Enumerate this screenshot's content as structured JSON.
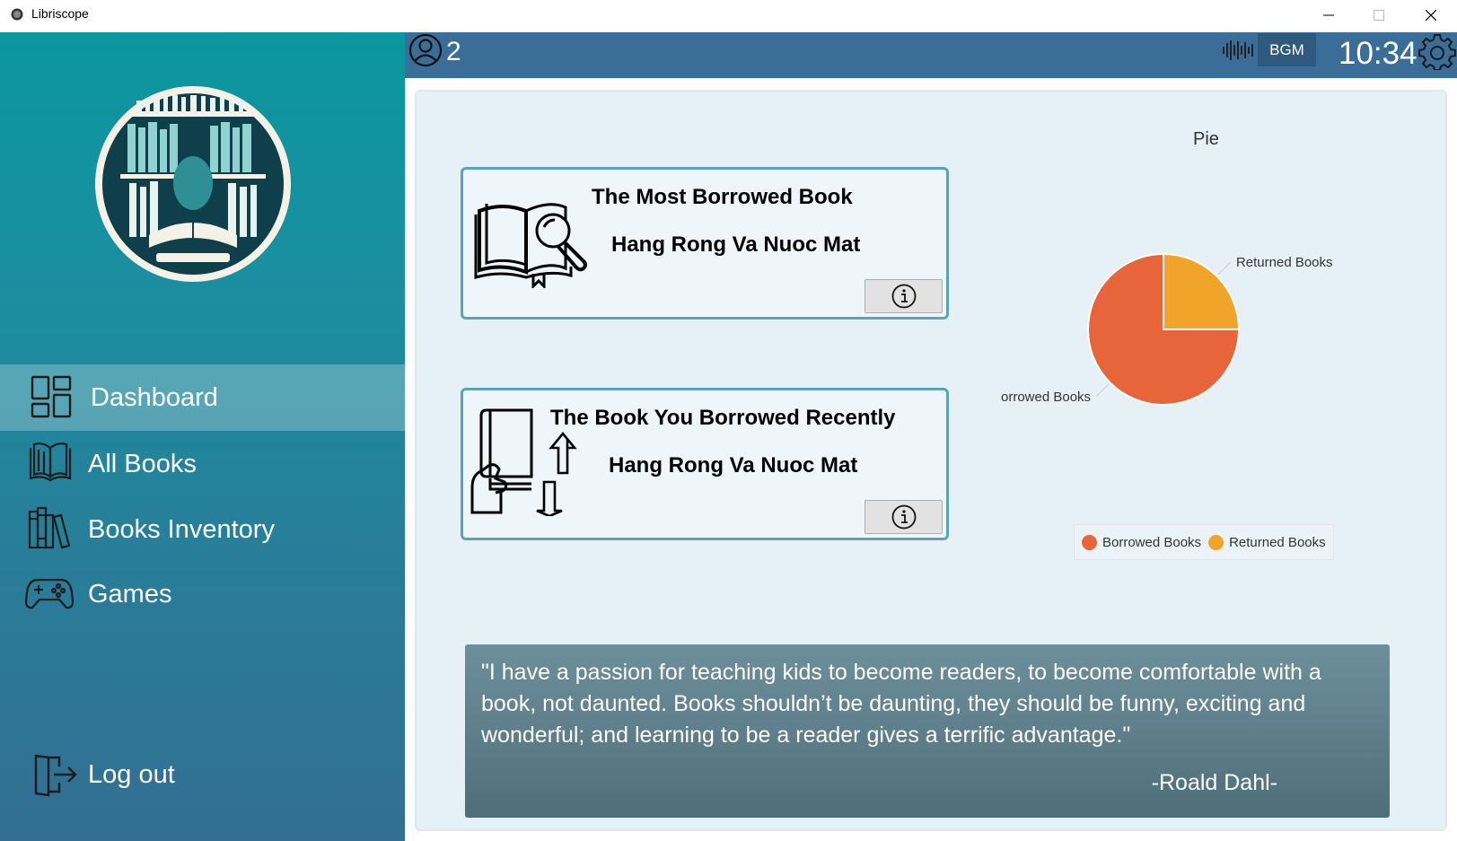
{
  "window": {
    "title": "Libriscope"
  },
  "sidebar": {
    "items": [
      {
        "label": "Dashboard",
        "icon": "dashboard-icon",
        "active": true
      },
      {
        "label": "All Books",
        "icon": "books-icon",
        "active": false
      },
      {
        "label": "Books Inventory",
        "icon": "inventory-icon",
        "active": false
      },
      {
        "label": "Games",
        "icon": "gamepad-icon",
        "active": false
      }
    ],
    "logout_label": "Log out"
  },
  "header": {
    "user_count": "2",
    "bgm_label": "BGM",
    "time": "10:34"
  },
  "cards": {
    "most_borrowed": {
      "title": "The Most Borrowed Book",
      "book": "Hang Rong Va Nuoc Mat"
    },
    "recent": {
      "title": "The Book You Borrowed Recently",
      "book": "Hang Rong Va Nuoc Mat"
    }
  },
  "chart_data": {
    "type": "pie",
    "title": "Pie",
    "slices": [
      {
        "label": "Borrowed Books",
        "value": 0.75,
        "color": "#e8643a"
      },
      {
        "label": "Returned Books",
        "value": 0.25,
        "color": "#f0a52a"
      }
    ],
    "legend_position": "bottom"
  },
  "quote": {
    "text": "\"I have a passion for teaching kids to become readers, to become comfortable with a book, not daunted. Books shouldn’t be daunting, they should be funny, exciting and wonderful; and learning to be a reader gives a terrific advantage.\"",
    "author": "-Roald Dahl-"
  },
  "colors": {
    "sidebar_top": "#0a979e",
    "sidebar_bottom": "#336f92",
    "header": "#3a6e98",
    "card_border": "#5ba4b8"
  }
}
